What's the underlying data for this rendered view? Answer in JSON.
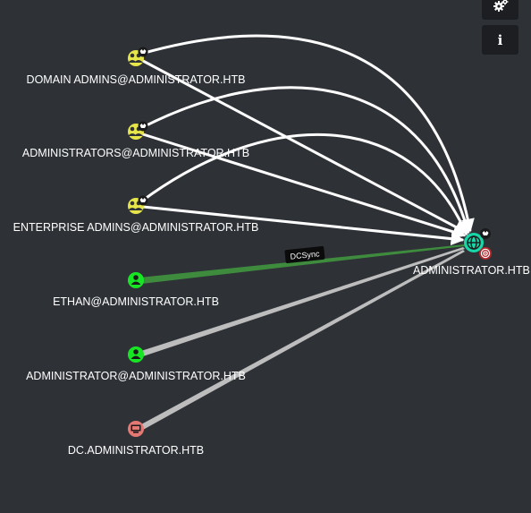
{
  "toolbar": {
    "settings_icon": "gears-icon",
    "info_icon": "info-icon",
    "info_glyph": "i"
  },
  "target": {
    "label": "ADMINISTRATOR.HTB",
    "type": "domain",
    "icon": "globe-icon",
    "badges": [
      "crown-icon",
      "target-icon"
    ]
  },
  "nodes": [
    {
      "id": "domain-admins",
      "label": "DOMAIN ADMINS@ADMINISTRATOR.HTB",
      "type": "group",
      "icon": "group-icon",
      "color": "#e6e64a"
    },
    {
      "id": "administrators",
      "label": "ADMINISTRATORS@ADMINISTRATOR.HTB",
      "type": "group",
      "icon": "group-icon",
      "color": "#e6e64a"
    },
    {
      "id": "enterprise-admins",
      "label": "ENTERPRISE ADMINS@ADMINISTRATOR.HTB",
      "type": "group",
      "icon": "group-icon",
      "color": "#e6e64a"
    },
    {
      "id": "ethan",
      "label": "ETHAN@ADMINISTRATOR.HTB",
      "type": "user",
      "icon": "user-icon",
      "color": "#17e625"
    },
    {
      "id": "administrator",
      "label": "ADMINISTRATOR@ADMINISTRATOR.HTB",
      "type": "user",
      "icon": "user-icon",
      "color": "#17e625"
    },
    {
      "id": "dc",
      "label": "DC.ADMINISTRATOR.HTB",
      "type": "computer",
      "icon": "computer-icon",
      "color": "#e67873"
    }
  ],
  "highlighted_edge": {
    "label": "DCSync",
    "color": "#3e8b3e"
  },
  "colors": {
    "background": "#2e3237",
    "edge": "#ffffff",
    "edge_muted": "#bdbdbd",
    "highlight": "#3e8b3e",
    "button_bg": "#1c1e22"
  }
}
